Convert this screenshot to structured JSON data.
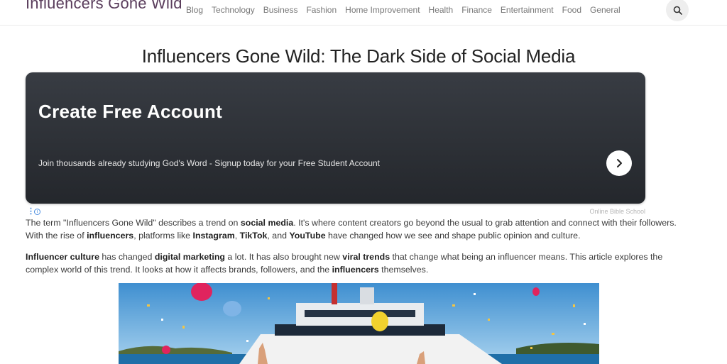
{
  "site": {
    "logo_text": "Influencers Gone Wild"
  },
  "nav": {
    "items": [
      {
        "label": "Blog"
      },
      {
        "label": "Technology"
      },
      {
        "label": "Business"
      },
      {
        "label": "Fashion"
      },
      {
        "label": "Home Improvement"
      },
      {
        "label": "Health"
      },
      {
        "label": "Finance"
      },
      {
        "label": "Entertainment"
      },
      {
        "label": "Food"
      },
      {
        "label": "General"
      }
    ],
    "search_icon": "search-icon"
  },
  "article": {
    "title": "Influencers Gone Wild: The Dark Side of Social Media",
    "paragraphs": [
      [
        {
          "t": "The term \"Influencers Gone Wild\" describes a trend on "
        },
        {
          "t": "social media",
          "b": true
        },
        {
          "t": ". It's where content creators go beyond the usual to grab attention and connect with their followers. With the rise of "
        },
        {
          "t": "influencers",
          "b": true
        },
        {
          "t": ", platforms like "
        },
        {
          "t": "Instagram",
          "b": true
        },
        {
          "t": ", "
        },
        {
          "t": "TikTok",
          "b": true
        },
        {
          "t": ", and "
        },
        {
          "t": "YouTube",
          "b": true
        },
        {
          "t": " have changed how we see and shape public opinion and culture."
        }
      ],
      [
        {
          "t": "Influencer culture",
          "b": true
        },
        {
          "t": " has changed "
        },
        {
          "t": "digital marketing",
          "b": true
        },
        {
          "t": " a lot. It has also brought new "
        },
        {
          "t": "viral trends",
          "b": true
        },
        {
          "t": " that change what being an influencer means. This article explores the complex world of this trend. It looks at how it affects brands, followers, and the "
        },
        {
          "t": "influencers",
          "b": true
        },
        {
          "t": " themselves."
        }
      ]
    ]
  },
  "ad": {
    "headline": "Create Free Account",
    "subtext": "Join thousands already studying God's Word - Signup today for your Free Student Account",
    "source": "Online Bible School",
    "options_glyph": "⋮",
    "info_glyph": "i",
    "arrow_icon": "chevron-right-icon"
  },
  "colors": {
    "logo": "#5a3d5c",
    "ad_background": "#2f3238",
    "ad_info": "#4a8de0"
  }
}
